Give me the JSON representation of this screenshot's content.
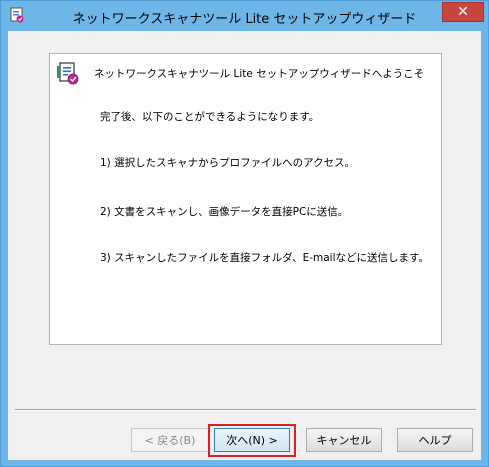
{
  "window": {
    "title": "ネットワークスキャナツール Lite セットアップウィザード",
    "close_glyph": "✕"
  },
  "content": {
    "welcome": "ネットワークスキャナツール Lite セットアップウィザードへようこそ",
    "lines": [
      "完了後、以下のことができるようになります。",
      "1) 選択したスキャナからプロファイルへのアクセス。",
      "2) 文書をスキャンし、画像データを直接PCに送信。",
      "3) スキャンしたファイルを直接フォルダ、E-mailなどに送信します。"
    ]
  },
  "buttons": {
    "back": "< 戻る(B)",
    "next": "次へ(N) >",
    "cancel": "キャンセル",
    "help": "ヘルプ"
  },
  "colors": {
    "titlebar": "#6fb6e8",
    "close": "#c7463c",
    "highlight": "#e02020"
  }
}
